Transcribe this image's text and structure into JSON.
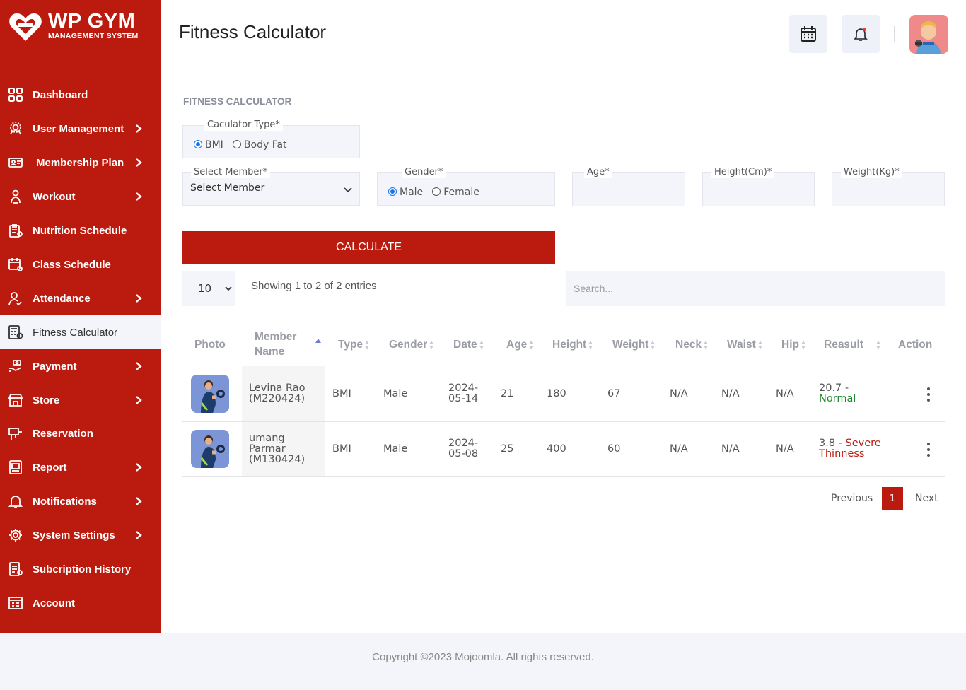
{
  "brand": {
    "title": "WP GYM",
    "subtitle": "MANAGEMENT SYSTEM"
  },
  "sidebar": {
    "items": [
      {
        "label": "Dashboard",
        "icon": "dashboard-icon",
        "has_submenu": false
      },
      {
        "label": "User Management",
        "icon": "users-gear-icon",
        "has_submenu": true
      },
      {
        "label": "Membership Plan",
        "icon": "id-card-icon",
        "has_submenu": true
      },
      {
        "label": "Workout",
        "icon": "workout-icon",
        "has_submenu": true
      },
      {
        "label": "Nutrition Schedule",
        "icon": "clipboard-icon",
        "has_submenu": false
      },
      {
        "label": "Class Schedule",
        "icon": "calendar-gear-icon",
        "has_submenu": false
      },
      {
        "label": "Attendance",
        "icon": "user-check-icon",
        "has_submenu": true
      },
      {
        "label": "Fitness Calculator",
        "icon": "calculator-icon",
        "has_submenu": false,
        "active": true
      },
      {
        "label": "Payment",
        "icon": "hand-money-icon",
        "has_submenu": true
      },
      {
        "label": "Store",
        "icon": "store-icon",
        "has_submenu": true
      },
      {
        "label": "Reservation",
        "icon": "reservation-icon",
        "has_submenu": false
      },
      {
        "label": "Report",
        "icon": "report-icon",
        "has_submenu": true
      },
      {
        "label": "Notifications",
        "icon": "bell-icon",
        "has_submenu": true
      },
      {
        "label": "System Settings",
        "icon": "gear-icon",
        "has_submenu": true
      },
      {
        "label": "Subcription History",
        "icon": "history-icon",
        "has_submenu": false
      },
      {
        "label": "Account",
        "icon": "account-icon",
        "has_submenu": false
      }
    ]
  },
  "header": {
    "title": "Fitness Calculator"
  },
  "form": {
    "section_title": "FITNESS CALCULATOR",
    "calc_type_label": "Caculator Type*",
    "calc_type_options": [
      "BMI",
      "Body Fat"
    ],
    "calc_type_selected": "BMI",
    "member_label": "Select Member*",
    "member_value": "Select Member",
    "gender_label": "Gender*",
    "gender_options": [
      "Male",
      "Female"
    ],
    "gender_selected": "Male",
    "age_label": "Age*",
    "height_label": "Height(Cm)*",
    "weight_label": "Weight(Kg)*",
    "calculate_label": "CALCULATE"
  },
  "table_controls": {
    "page_length": "10",
    "showing_text": "Showing 1 to 2 of 2 entries",
    "search_placeholder": "Search..."
  },
  "table": {
    "headers": {
      "photo": "Photo",
      "member_name_1": "Member",
      "member_name_2": "Name",
      "type": "Type",
      "gender": "Gender",
      "date": "Date",
      "age": "Age",
      "height": "Height",
      "weight": "Weight",
      "neck": "Neck",
      "waist": "Waist",
      "hip": "Hip",
      "result": "Reasult",
      "action": "Action"
    },
    "rows": [
      {
        "name_1": "Levina Rao",
        "name_2": "(M220424)",
        "name_3": "",
        "type": "BMI",
        "gender": "Male",
        "date_1": "2024-",
        "date_2": "05-14",
        "age": "21",
        "height": "180",
        "weight": "67",
        "neck": "N/A",
        "waist": "N/A",
        "hip": "N/A",
        "result_value": "20.7 -",
        "result_label": "Normal"
      },
      {
        "name_1": "umang",
        "name_2": "Parmar",
        "name_3": "(M130424)",
        "type": "BMI",
        "gender": "Male",
        "date_1": "2024-",
        "date_2": "05-08",
        "age": "25",
        "height": "400",
        "weight": "60",
        "neck": "N/A",
        "waist": "N/A",
        "hip": "N/A",
        "result_value": "3.8 -",
        "result_label_1": "Severe",
        "result_label_2": "Thinness"
      }
    ]
  },
  "pagination": {
    "previous": "Previous",
    "current": "1",
    "next": "Next"
  },
  "footer": {
    "copyright": "Copyright ©2023 Mojoomla. All rights reserved."
  },
  "colors": {
    "brand_red": "#bb1b0f",
    "panel_bg": "#f3f5fa",
    "normal_green": "#1f8a2e"
  }
}
